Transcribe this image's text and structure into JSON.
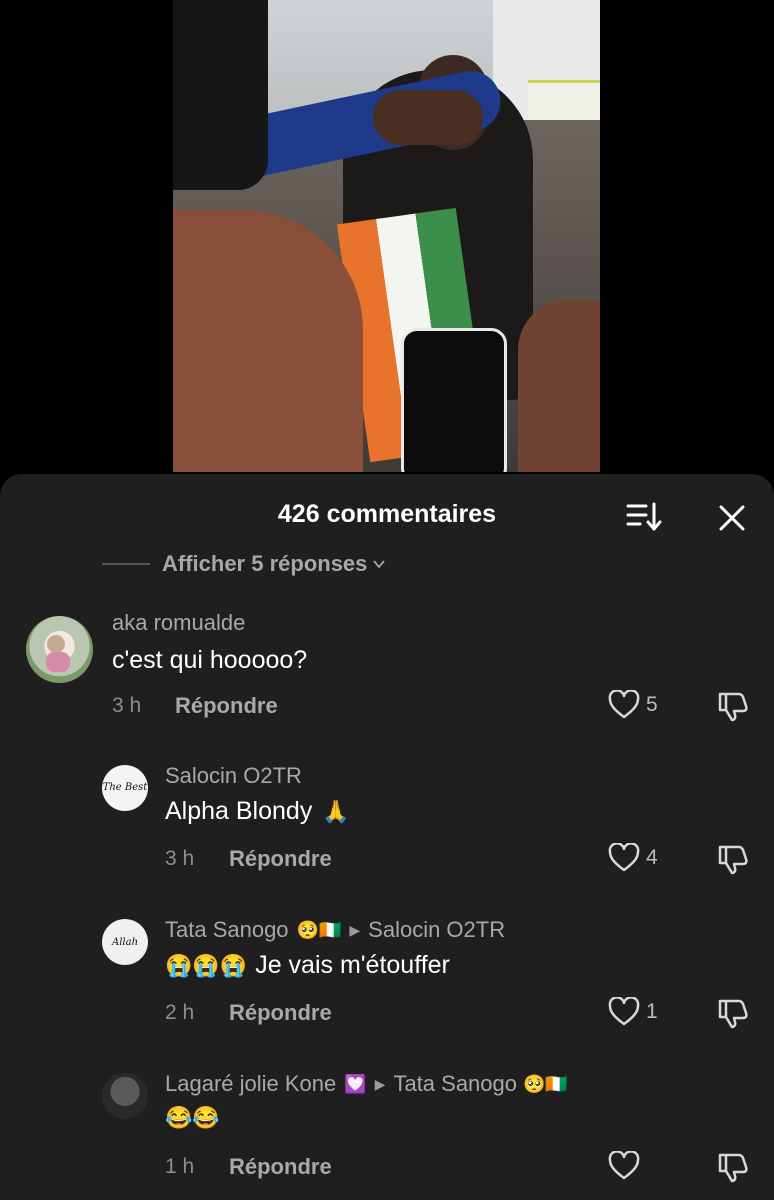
{
  "sheet": {
    "title": "426 commentaires"
  },
  "more_replies": "Afficher 5 réponses",
  "comments": [
    {
      "username": "aka romualde",
      "text": "c'est qui hooooo?",
      "time": "3 h",
      "reply_label": "Répondre",
      "likes": "5"
    },
    {
      "username": "Salocin O2TR",
      "text": "Alpha Blondy",
      "text_emoji": "🙏",
      "time": "3 h",
      "reply_label": "Répondre",
      "likes": "4",
      "avatar_text": "The Best"
    },
    {
      "username": "Tata Sanogo",
      "username_emoji": "🥺🇨🇮",
      "reply_to": "Salocin O2TR",
      "text_emoji": "😭😭😭",
      "text": "Je vais m'étouffer",
      "time": "2 h",
      "reply_label": "Répondre",
      "likes": "1",
      "avatar_text": "Allah"
    },
    {
      "username": "Lagaré jolie Kone",
      "username_emoji": "💟",
      "reply_to": "Tata Sanogo",
      "reply_to_emoji": "🥺🇨🇮",
      "text_emoji": "😂😂",
      "time": "1 h",
      "reply_label": "Répondre",
      "likes": ""
    }
  ],
  "colors": {
    "sheet_bg": "#1f1f1f",
    "username": "#a9a9a9",
    "text": "#ffffff",
    "meta": "#8d8d8d"
  }
}
